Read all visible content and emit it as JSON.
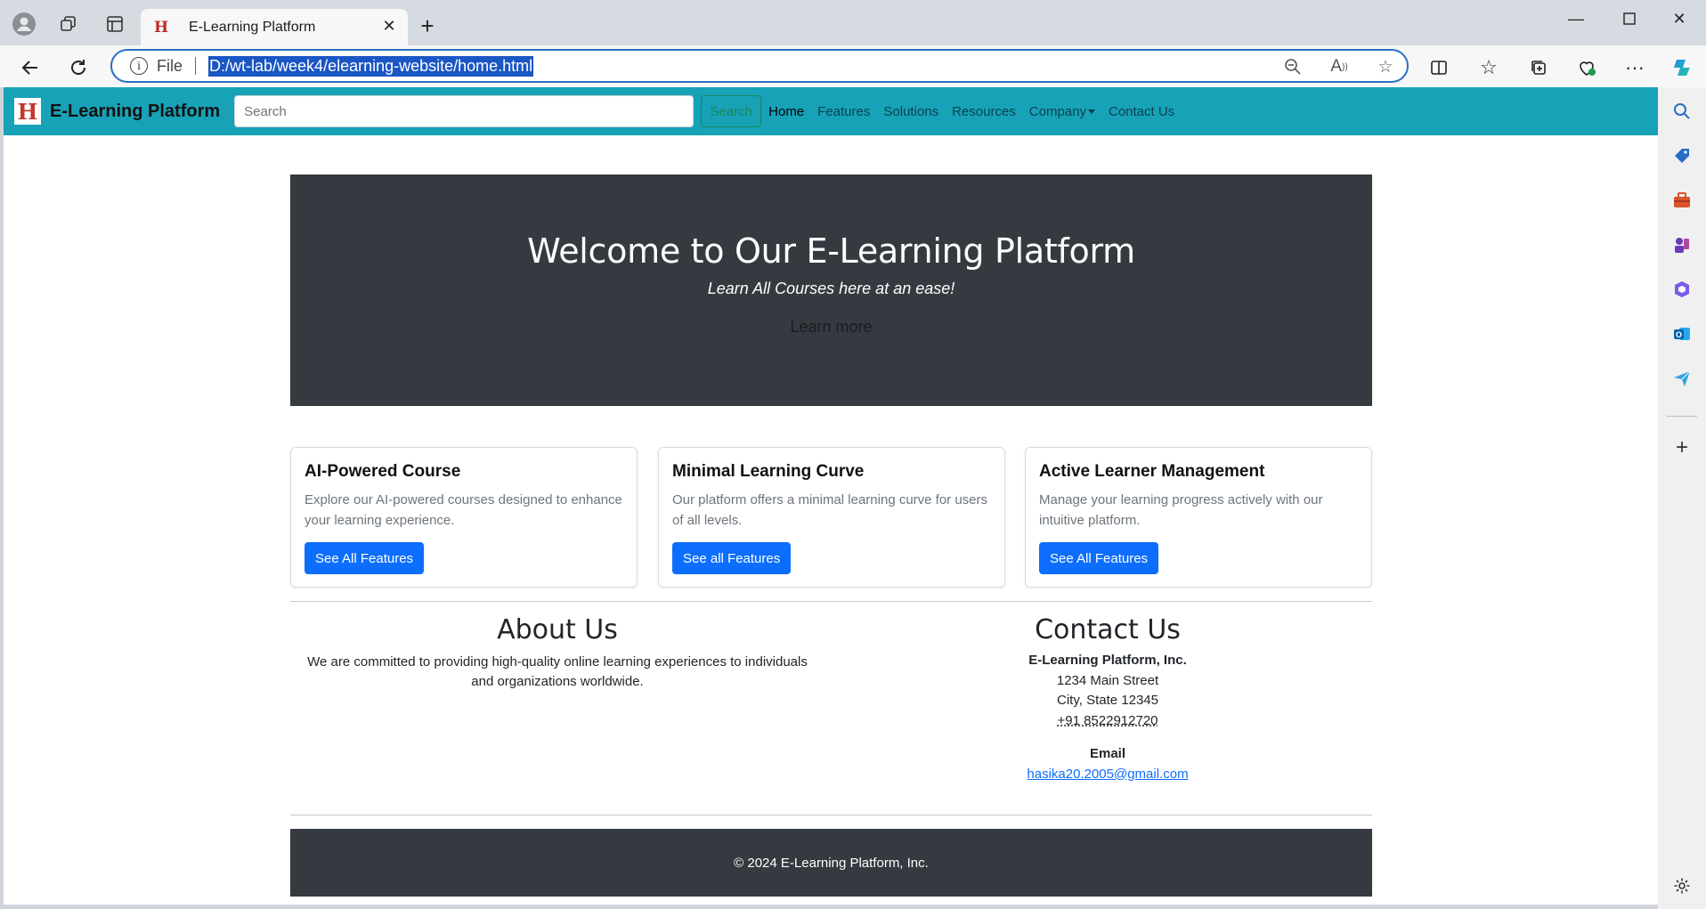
{
  "browser": {
    "tab_title": "E-Learning Platform",
    "address_scheme": "File",
    "address_url": "D:/wt-lab/week4/elearning-website/home.html"
  },
  "site": {
    "brand": "E-Learning Platform",
    "search_placeholder": "Search",
    "search_button": "Search",
    "nav": {
      "home": "Home",
      "features": "Features",
      "solutions": "Solutions",
      "resources": "Resources",
      "company": "Company",
      "contact": "Contact Us"
    }
  },
  "hero": {
    "title": "Welcome to Our E-Learning Platform",
    "subtitle": "Learn All Courses here at an ease!",
    "button": "Learn more"
  },
  "cards": [
    {
      "title": "AI-Powered Course",
      "text": "Explore our AI-powered courses designed to enhance your learning experience.",
      "button": "See All Features"
    },
    {
      "title": "Minimal Learning Curve",
      "text": "Our platform offers a minimal learning curve for users of all levels.",
      "button": "See all Features"
    },
    {
      "title": "Active Learner Management",
      "text": "Manage your learning progress actively with our intuitive platform.",
      "button": "See All Features"
    }
  ],
  "about": {
    "title": "About Us",
    "text": "We are committed to providing high-quality online learning experiences to individuals and organizations worldwide."
  },
  "contact": {
    "title": "Contact Us",
    "company": "E-Learning Platform, Inc.",
    "street": "1234 Main Street",
    "city": "City, State 12345",
    "phone": "+91 8522912720",
    "email_label": "Email",
    "email": "hasika20.2005@gmail.com"
  },
  "footer": {
    "text": "© 2024 E-Learning Platform, Inc."
  },
  "colors": {
    "navbar": "#17a2b8",
    "hero_bg": "#343a40",
    "primary_button": "#0d6efd",
    "address_highlight": "#1a56c4"
  }
}
